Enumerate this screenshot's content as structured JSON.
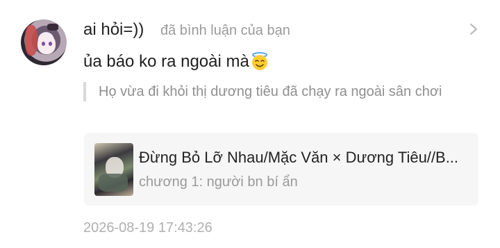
{
  "comment": {
    "username": "ai hỏi=))",
    "action": "đã bình luận của bạn",
    "content": "ủa báo ko ra ngoài mà",
    "content_emoji": "smiling-face-with-halo",
    "quoted_text": "Họ vừa đi khỏi thị dương tiêu đã chạy ra ngoài sân chơi",
    "timestamp": "2026-08-19 17:43:26"
  },
  "card": {
    "title": "Đừng Bỏ Lỡ Nhau/Mặc Văn × Dương Tiêu//B...",
    "subtitle": "chương 1: người bn bí ẩn"
  },
  "icons": {
    "open": "chevron-right-icon"
  },
  "colors": {
    "secondary_text": "#9a9a9a",
    "card_background": "#f6f6f6",
    "quote_bar": "#d9d9d9"
  }
}
